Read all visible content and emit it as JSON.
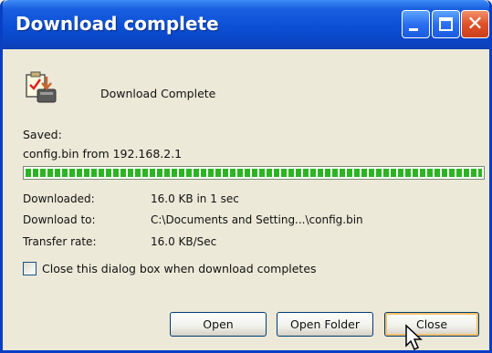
{
  "window": {
    "title": "Download complete",
    "controls": {
      "minimize": "minimize-icon",
      "maximize": "maximize-icon",
      "close": "close-icon",
      "close_glyph": "✕"
    }
  },
  "dialog": {
    "icon": "document-download-icon",
    "heading": "Download Complete",
    "saved_label": "Saved:",
    "saved_value": "config.bin from 192.168.2.1",
    "progress": 1.0,
    "details": [
      {
        "label": "Downloaded:",
        "value": "16.0 KB in 1 sec"
      },
      {
        "label": "Download to:",
        "value": "C:\\Documents and Setting...\\config.bin"
      },
      {
        "label": "Transfer rate:",
        "value": "16.0 KB/Sec"
      }
    ],
    "checkbox_label": "Close this dialog box when download completes",
    "checkbox_checked": false
  },
  "buttons": {
    "open": "Open",
    "open_folder": "Open Folder",
    "close": "Close"
  },
  "colors": {
    "titlebar": "#0b4fd6",
    "progress": "#2cb522",
    "window_bg": "#ece9d8"
  }
}
